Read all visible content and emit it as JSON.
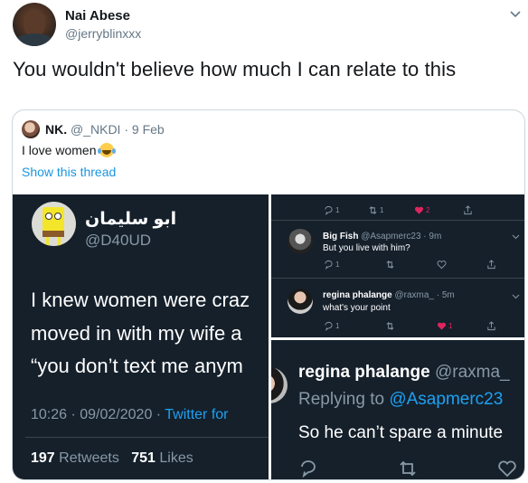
{
  "tweet": {
    "author_name": "Nai Abese",
    "author_handle": "@jerryblinxxx",
    "text": "You wouldn't believe how much I can relate to this"
  },
  "quoted": {
    "name": "NK.",
    "handle_date": "@_NKDI · 9 Feb",
    "text": "I love women",
    "show_thread": "Show this thread"
  },
  "media_left": {
    "name": "ابو سليمان",
    "handle": "@D40UD",
    "line1": "I knew women were craz",
    "line2": "moved in with my wife a",
    "line3": "“you don’t text me anym",
    "time_date": "10:26 · 09/02/2020 · ",
    "source": "Twitter for",
    "retweets_count": "197",
    "retweets_label": "Retweets",
    "likes_count": "751",
    "likes_label": "Likes"
  },
  "media_top_right": {
    "counts": {
      "reply": "1",
      "retweet": "1",
      "like": "2",
      "like2": "1"
    },
    "reply1": {
      "name": "Big Fish",
      "handle_time": "@Asapmerc23 · 9m",
      "text": "But you live with him?"
    },
    "reply2": {
      "name": "regina phalange",
      "handle_time": "@raxma_ · 5m",
      "text": "what's your point"
    }
  },
  "media_bottom_right": {
    "name": "regina phalange",
    "handle": "@raxma_",
    "replying_to": "Replying to",
    "replying_handle": "@Asapmerc23",
    "text": "So he can’t spare a minute"
  },
  "colors": {
    "link": "#1b95e0",
    "dark_bg": "#15202b",
    "muted": "#8899a6",
    "like_red": "#e0245e"
  }
}
